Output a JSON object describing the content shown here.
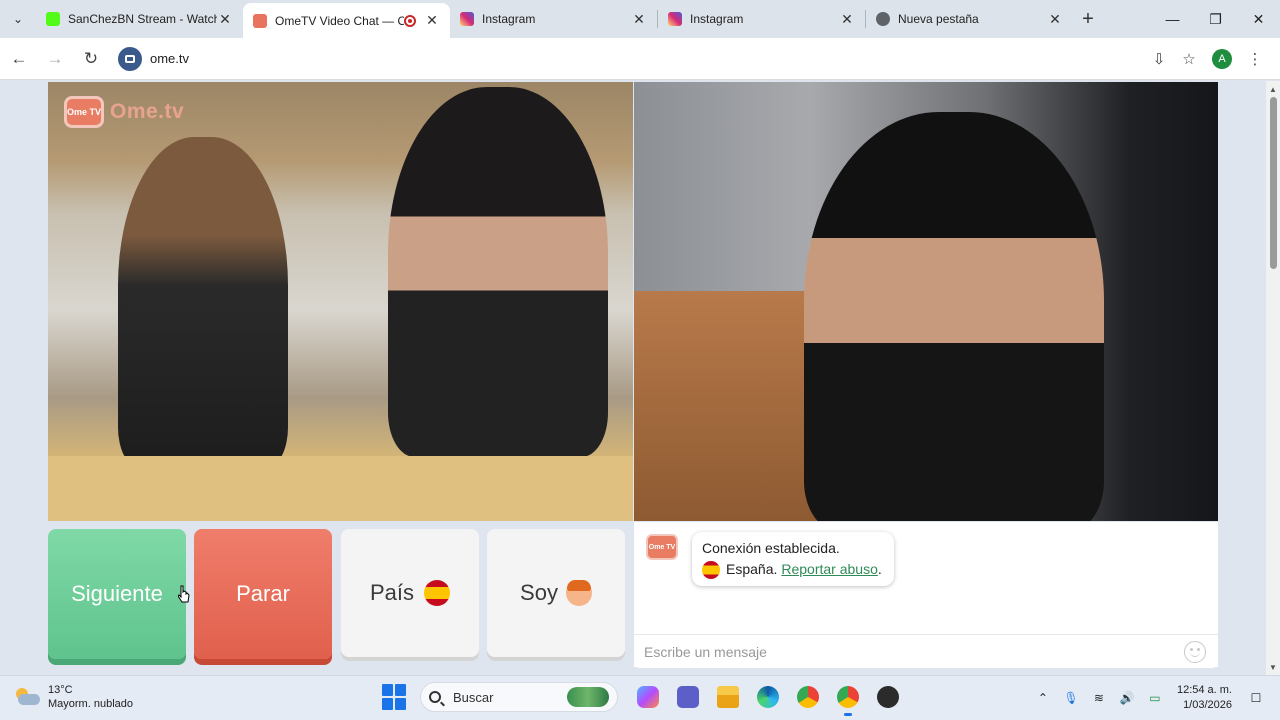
{
  "browser": {
    "tabs": [
      {
        "title": "SanChezBN Stream - Watch",
        "favicon_color": "#53fc18",
        "active": false
      },
      {
        "title": "OmeTV Video Chat — O",
        "favicon_color": "#e8735f",
        "active": true,
        "recording": true
      },
      {
        "title": "Instagram",
        "favicon_color": "#d62976",
        "active": false
      },
      {
        "title": "Instagram",
        "favicon_color": "#d62976",
        "active": false
      },
      {
        "title": "Nueva pestaña",
        "favicon_color": "#5f6368",
        "active": false
      }
    ],
    "url": "ome.tv",
    "avatar_letter": "A"
  },
  "page": {
    "watermark": {
      "logo_text": "Ome TV",
      "brand": "Ome.tv"
    },
    "buttons": {
      "next": "Siguiente",
      "stop": "Parar",
      "country": "País",
      "gender": "Soy"
    },
    "chat": {
      "logo_text": "Ome TV",
      "status": "Conexión establecida.",
      "country": "España.",
      "report_link": "Reportar abuso",
      "report_suffix": ".",
      "input_placeholder": "Escribe un mensaje"
    },
    "colors": {
      "next": "#5fc38e",
      "stop": "#e0604c",
      "link": "#2e8b57"
    }
  },
  "taskbar": {
    "weather": {
      "temp": "13°C",
      "condition": "Mayorm. nublado"
    },
    "search_placeholder": "Buscar",
    "time": "12:54 a. m.",
    "date": "1/03/2026"
  }
}
